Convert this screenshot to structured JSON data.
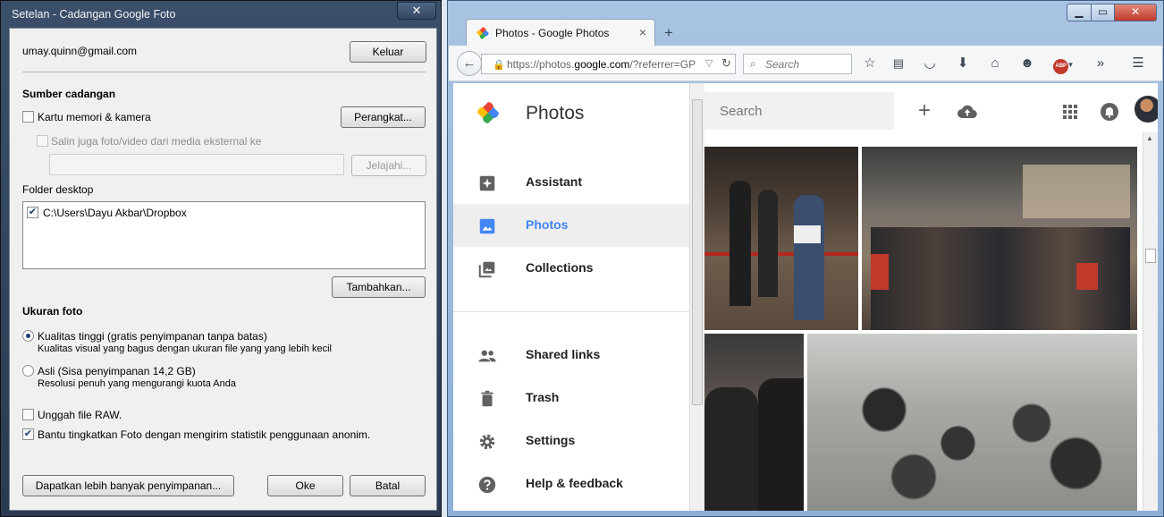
{
  "dialog": {
    "title": "Setelan - Cadangan Google Foto",
    "close_symbol": "✕",
    "account_email": "umay.quinn@gmail.com",
    "signout_label": "Keluar",
    "source_heading": "Sumber cadangan",
    "memory_card_label": "Kartu memori & kamera",
    "devices_button": "Perangkat...",
    "copy_external_label": "Salin juga foto/video dari media eksternal ke",
    "browse_button": "Jelajahi...",
    "desktop_folder_heading": "Folder desktop",
    "folder_path": "C:\\Users\\Dayu Akbar\\Dropbox",
    "add_button": "Tambahkan...",
    "photo_size_heading": "Ukuran foto",
    "high_quality_label": "Kualitas tinggi (gratis penyimpanan tanpa batas)",
    "high_quality_desc": "Kualitas visual yang bagus dengan ukuran file yang yang lebih kecil",
    "original_label": "Asli (Sisa penyimpanan 14,2 GB)",
    "original_desc": "Resolusi penuh yang mengurangi kuota Anda",
    "raw_label": "Unggah file RAW.",
    "stats_label": "Bantu tingkatkan Foto dengan mengirim statistik penggunaan anonim.",
    "more_storage_button": "Dapatkan lebih banyak penyimpanan...",
    "ok_button": "Oke",
    "cancel_button": "Batal",
    "check_mark": "✔"
  },
  "browser": {
    "tab_title": "Photos - Google Photos",
    "tab_close": "×",
    "new_tab": "+",
    "url": "https://photos.google.com/?referrer=GP",
    "url_prefix": "https://photos.",
    "url_domain": "google.com",
    "url_suffix": "/?referrer=GP",
    "search_placeholder": "Search",
    "abp_label": "ABP"
  },
  "page": {
    "brand": "Photos",
    "search_placeholder": "Search",
    "nav_items": [
      {
        "label": "Assistant",
        "icon": "assistant-icon"
      },
      {
        "label": "Photos",
        "icon": "photos-icon"
      },
      {
        "label": "Collections",
        "icon": "collections-icon"
      },
      {
        "label": "Shared links",
        "icon": "shared-links-icon"
      },
      {
        "label": "Trash",
        "icon": "trash-icon"
      },
      {
        "label": "Settings",
        "icon": "settings-icon"
      },
      {
        "label": "Help & feedback",
        "icon": "help-icon"
      }
    ],
    "active_nav": "Photos",
    "accent_color": "#4285f4"
  }
}
